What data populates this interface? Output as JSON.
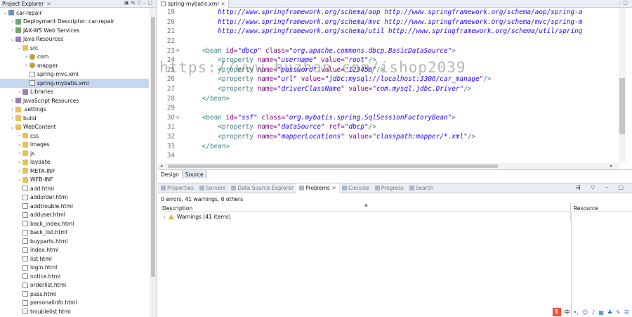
{
  "project_explorer": {
    "title": "Project Explorer",
    "items": [
      {
        "label": "car-repair",
        "icon": "project-icon",
        "level": 0,
        "expanded": true
      },
      {
        "label": "Deployment Descriptor: car-repair",
        "icon": "deployment-icon",
        "level": 1,
        "expanded": false
      },
      {
        "label": "JAX-WS Web Services",
        "icon": "webservice-icon",
        "level": 1,
        "expanded": false
      },
      {
        "label": "Java Resources",
        "icon": "java-resources-icon",
        "level": 1,
        "expanded": true
      },
      {
        "label": "src",
        "icon": "source-folder-icon",
        "level": 2,
        "expanded": true
      },
      {
        "label": "com",
        "icon": "package-icon",
        "level": 3,
        "expanded": false
      },
      {
        "label": "mapper",
        "icon": "package-icon",
        "level": 3,
        "expanded": false
      },
      {
        "label": "spring-mvc.xml",
        "icon": "xml-file-icon",
        "level": 3
      },
      {
        "label": "spring-mybatis.xml",
        "icon": "xml-file-icon",
        "level": 3,
        "selected": true
      },
      {
        "label": "Libraries",
        "icon": "libraries-icon",
        "level": 2,
        "expanded": false
      },
      {
        "label": "JavaScript Resources",
        "icon": "js-resources-icon",
        "level": 1,
        "expanded": false
      },
      {
        "label": ".settings",
        "icon": "folder-icon",
        "level": 1,
        "expanded": false
      },
      {
        "label": "build",
        "icon": "folder-icon",
        "level": 1,
        "expanded": false
      },
      {
        "label": "WebContent",
        "icon": "folder-icon",
        "level": 1,
        "expanded": true
      },
      {
        "label": "css",
        "icon": "folder-icon",
        "level": 2,
        "expanded": false
      },
      {
        "label": "images",
        "icon": "folder-icon",
        "level": 2,
        "expanded": false
      },
      {
        "label": "js",
        "icon": "folder-icon",
        "level": 2,
        "expanded": false
      },
      {
        "label": "laydate",
        "icon": "folder-icon",
        "level": 2,
        "expanded": false
      },
      {
        "label": "META-INF",
        "icon": "folder-icon",
        "level": 2,
        "expanded": false
      },
      {
        "label": "WEB-INF",
        "icon": "folder-icon",
        "level": 2,
        "expanded": false
      },
      {
        "label": "add.html",
        "icon": "html-file-icon",
        "level": 2
      },
      {
        "label": "addorder.html",
        "icon": "html-file-icon",
        "level": 2
      },
      {
        "label": "addtrouble.html",
        "icon": "html-file-icon",
        "level": 2
      },
      {
        "label": "adduser.html",
        "icon": "html-file-icon",
        "level": 2
      },
      {
        "label": "back_index.html",
        "icon": "html-file-icon",
        "level": 2
      },
      {
        "label": "back_list.html",
        "icon": "html-file-icon",
        "level": 2
      },
      {
        "label": "buyparts.html",
        "icon": "html-file-icon",
        "level": 2
      },
      {
        "label": "index.html",
        "icon": "html-file-icon",
        "level": 2
      },
      {
        "label": "list.html",
        "icon": "html-file-icon",
        "level": 2
      },
      {
        "label": "login.html",
        "icon": "html-file-icon",
        "level": 2
      },
      {
        "label": "notice.html",
        "icon": "html-file-icon",
        "level": 2
      },
      {
        "label": "orderlist.html",
        "icon": "html-file-icon",
        "level": 2
      },
      {
        "label": "pass.html",
        "icon": "html-file-icon",
        "level": 2
      },
      {
        "label": "personalinfo.html",
        "icon": "html-file-icon",
        "level": 2
      },
      {
        "label": "troublelist.html",
        "icon": "html-file-icon",
        "level": 2
      }
    ]
  },
  "editor": {
    "tab_label": "spring-mybatis.xml",
    "lines": [
      {
        "num": "19",
        "fold": "",
        "parts": [
          [
            "",
            "        "
          ],
          [
            "url",
            "http://www.springframework.org/schema/aop http://www.springframework.org/schema/aop/spring-a"
          ]
        ]
      },
      {
        "num": "20",
        "fold": "",
        "parts": [
          [
            "",
            "        "
          ],
          [
            "url",
            "http://www.springframework.org/schema/mvc http://www.springframework.org/schema/mvc/spring-m"
          ]
        ]
      },
      {
        "num": "21",
        "fold": "",
        "parts": [
          [
            "",
            "        "
          ],
          [
            "url",
            "http://www.springframework.org/schema/util http://www.springframework.org/schema/util/spring"
          ]
        ]
      },
      {
        "num": "22",
        "fold": "",
        "parts": []
      },
      {
        "num": "23",
        "fold": "⊖",
        "parts": [
          [
            "",
            "    "
          ],
          [
            "tag",
            "<bean "
          ],
          [
            "attr",
            "id="
          ],
          [
            "val",
            "\"dbcp\""
          ],
          [
            "attr",
            " class="
          ],
          [
            "val",
            "\"org.apache.commons.dbcp.BasicDataSource\""
          ],
          [
            "tag",
            ">"
          ]
        ]
      },
      {
        "num": "24",
        "fold": "",
        "parts": [
          [
            "",
            "        "
          ],
          [
            "tag",
            "<property "
          ],
          [
            "attr",
            "name="
          ],
          [
            "val",
            "\"username\""
          ],
          [
            "attr",
            " value="
          ],
          [
            "val",
            "\"root\""
          ],
          [
            "tag",
            "/>"
          ]
        ]
      },
      {
        "num": "25",
        "fold": "",
        "parts": [
          [
            "",
            "        "
          ],
          [
            "tag",
            "<property "
          ],
          [
            "attr",
            "name="
          ],
          [
            "val",
            "\"password\""
          ],
          [
            "attr",
            " value="
          ],
          [
            "val",
            "\"123456\""
          ],
          [
            "tag",
            "/>"
          ]
        ]
      },
      {
        "num": "26",
        "fold": "",
        "parts": [
          [
            "",
            "        "
          ],
          [
            "tag",
            "<property "
          ],
          [
            "attr",
            "name="
          ],
          [
            "val",
            "\"url\""
          ],
          [
            "attr",
            " value="
          ],
          [
            "val",
            "\"jdbc:mysql://localhost:3306/car_manage\""
          ],
          [
            "tag",
            "/>"
          ]
        ]
      },
      {
        "num": "27",
        "fold": "",
        "parts": [
          [
            "",
            "        "
          ],
          [
            "tag",
            "<property "
          ],
          [
            "attr",
            "name="
          ],
          [
            "val",
            "\"driverClassName\""
          ],
          [
            "attr",
            " value="
          ],
          [
            "val",
            "\"com.mysql.jdbc.Driver\""
          ],
          [
            "tag",
            "/>"
          ]
        ]
      },
      {
        "num": "28",
        "fold": "",
        "parts": [
          [
            "",
            "    "
          ],
          [
            "tag",
            "</bean>"
          ]
        ]
      },
      {
        "num": "29",
        "fold": "",
        "parts": []
      },
      {
        "num": "30",
        "fold": "⊖",
        "parts": [
          [
            "",
            "    "
          ],
          [
            "tag",
            "<bean "
          ],
          [
            "attr",
            "id="
          ],
          [
            "val",
            "\"ssf\""
          ],
          [
            "attr",
            " class="
          ],
          [
            "val",
            "\"org.mybatis.spring.SqlSessionFactoryBean\""
          ],
          [
            "tag",
            ">"
          ]
        ]
      },
      {
        "num": "31",
        "fold": "",
        "parts": [
          [
            "",
            "        "
          ],
          [
            "tag",
            "<property "
          ],
          [
            "attr",
            "name="
          ],
          [
            "val",
            "\"dataSource\""
          ],
          [
            "attr",
            " ref="
          ],
          [
            "val",
            "\"dbcp\""
          ],
          [
            "tag",
            "/>"
          ]
        ]
      },
      {
        "num": "32",
        "fold": "",
        "parts": [
          [
            "",
            "        "
          ],
          [
            "tag",
            "<property "
          ],
          [
            "attr",
            "name="
          ],
          [
            "val",
            "\"mapperLocations\""
          ],
          [
            "attr",
            " value="
          ],
          [
            "val",
            "\"classpath:mapper/*.xml\""
          ],
          [
            "tag",
            "/>"
          ]
        ]
      },
      {
        "num": "33",
        "fold": "",
        "parts": [
          [
            "",
            "    "
          ],
          [
            "tag",
            "</bean>"
          ]
        ]
      },
      {
        "num": "34",
        "fold": "",
        "parts": []
      }
    ],
    "design_tab": "Design",
    "source_tab": "Source"
  },
  "watermark": "https://www.huzhan.com/ishop2039",
  "views": {
    "tabs": [
      {
        "label": "Properties",
        "icon": "properties-icon"
      },
      {
        "label": "Servers",
        "icon": "servers-icon"
      },
      {
        "label": "Data Source Explorer",
        "icon": "datasource-icon"
      },
      {
        "label": "Problems",
        "icon": "problems-icon",
        "active": true
      },
      {
        "label": "Console",
        "icon": "console-icon"
      },
      {
        "label": "Progress",
        "icon": "progress-icon"
      },
      {
        "label": "Search",
        "icon": "search-icon"
      }
    ],
    "summary": "0 errors, 41 warnings, 0 others",
    "col_description": "Description",
    "col_resource": "Resource",
    "warning_row": "Warnings (41 items)"
  },
  "tray": {
    "s_label": "S",
    "zh_label": "中"
  }
}
